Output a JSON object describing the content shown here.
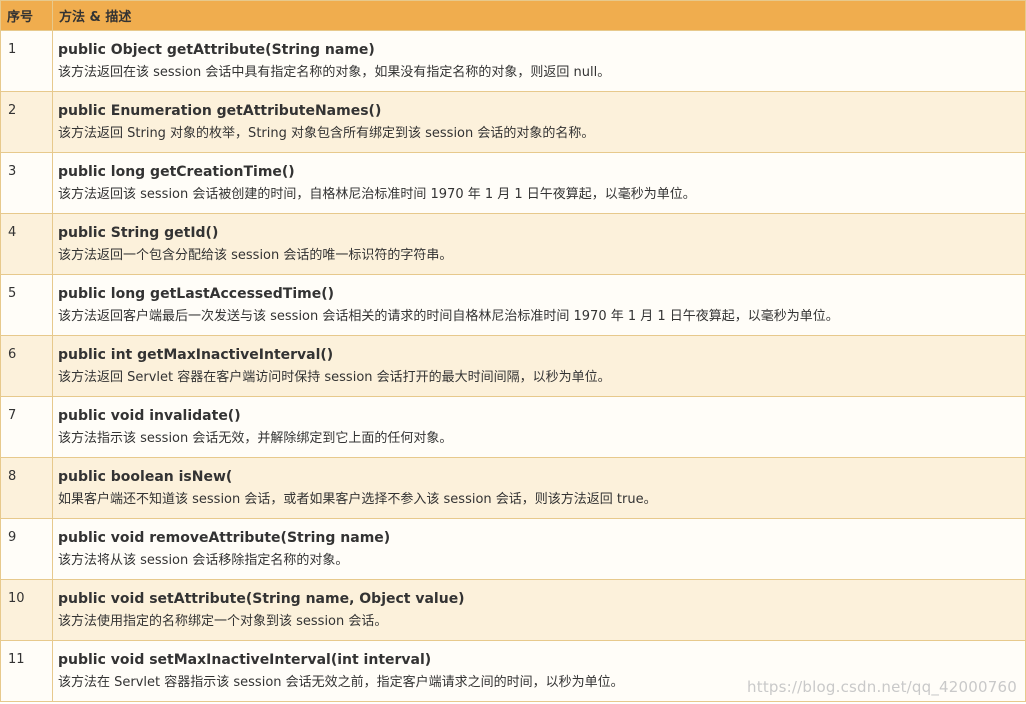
{
  "table": {
    "header": {
      "number": "序号",
      "description": "方法 & 描述"
    },
    "rows": [
      {
        "number": "1",
        "signature": "public Object getAttribute(String name)",
        "description": "该方法返回在该 session 会话中具有指定名称的对象，如果没有指定名称的对象，则返回 null。"
      },
      {
        "number": "2",
        "signature": "public Enumeration getAttributeNames()",
        "description": "该方法返回 String 对象的枚举，String 对象包含所有绑定到该 session 会话的对象的名称。"
      },
      {
        "number": "3",
        "signature": "public long getCreationTime()",
        "description": "该方法返回该 session 会话被创建的时间，自格林尼治标准时间 1970 年 1 月 1 日午夜算起，以毫秒为单位。"
      },
      {
        "number": "4",
        "signature": "public String getId()",
        "description": "该方法返回一个包含分配给该 session 会话的唯一标识符的字符串。"
      },
      {
        "number": "5",
        "signature": "public long getLastAccessedTime()",
        "description": "该方法返回客户端最后一次发送与该 session 会话相关的请求的时间自格林尼治标准时间 1970 年 1 月 1 日午夜算起，以毫秒为单位。"
      },
      {
        "number": "6",
        "signature": "public int getMaxInactiveInterval()",
        "description": "该方法返回 Servlet 容器在客户端访问时保持 session 会话打开的最大时间间隔，以秒为单位。"
      },
      {
        "number": "7",
        "signature": "public void invalidate()",
        "description": "该方法指示该 session 会话无效，并解除绑定到它上面的任何对象。"
      },
      {
        "number": "8",
        "signature": "public boolean isNew(",
        "description": "如果客户端还不知道该 session 会话，或者如果客户选择不参入该 session 会话，则该方法返回 true。"
      },
      {
        "number": "9",
        "signature": "public void removeAttribute(String name)",
        "description": "该方法将从该 session 会话移除指定名称的对象。"
      },
      {
        "number": "10",
        "signature": "public void setAttribute(String name, Object value)",
        "description": "该方法使用指定的名称绑定一个对象到该 session 会话。"
      },
      {
        "number": "11",
        "signature": "public void setMaxInactiveInterval(int interval)",
        "description": "该方法在 Servlet 容器指示该 session 会话无效之前，指定客户端请求之间的时间，以秒为单位。"
      }
    ]
  },
  "watermark": "https://blog.csdn.net/qq_42000760",
  "colors": {
    "header_bg": "#f0ad4e",
    "row_odd_bg": "#fffdf8",
    "row_even_bg": "#fcf1db",
    "border": "#e7c98c",
    "text": "#333333"
  }
}
